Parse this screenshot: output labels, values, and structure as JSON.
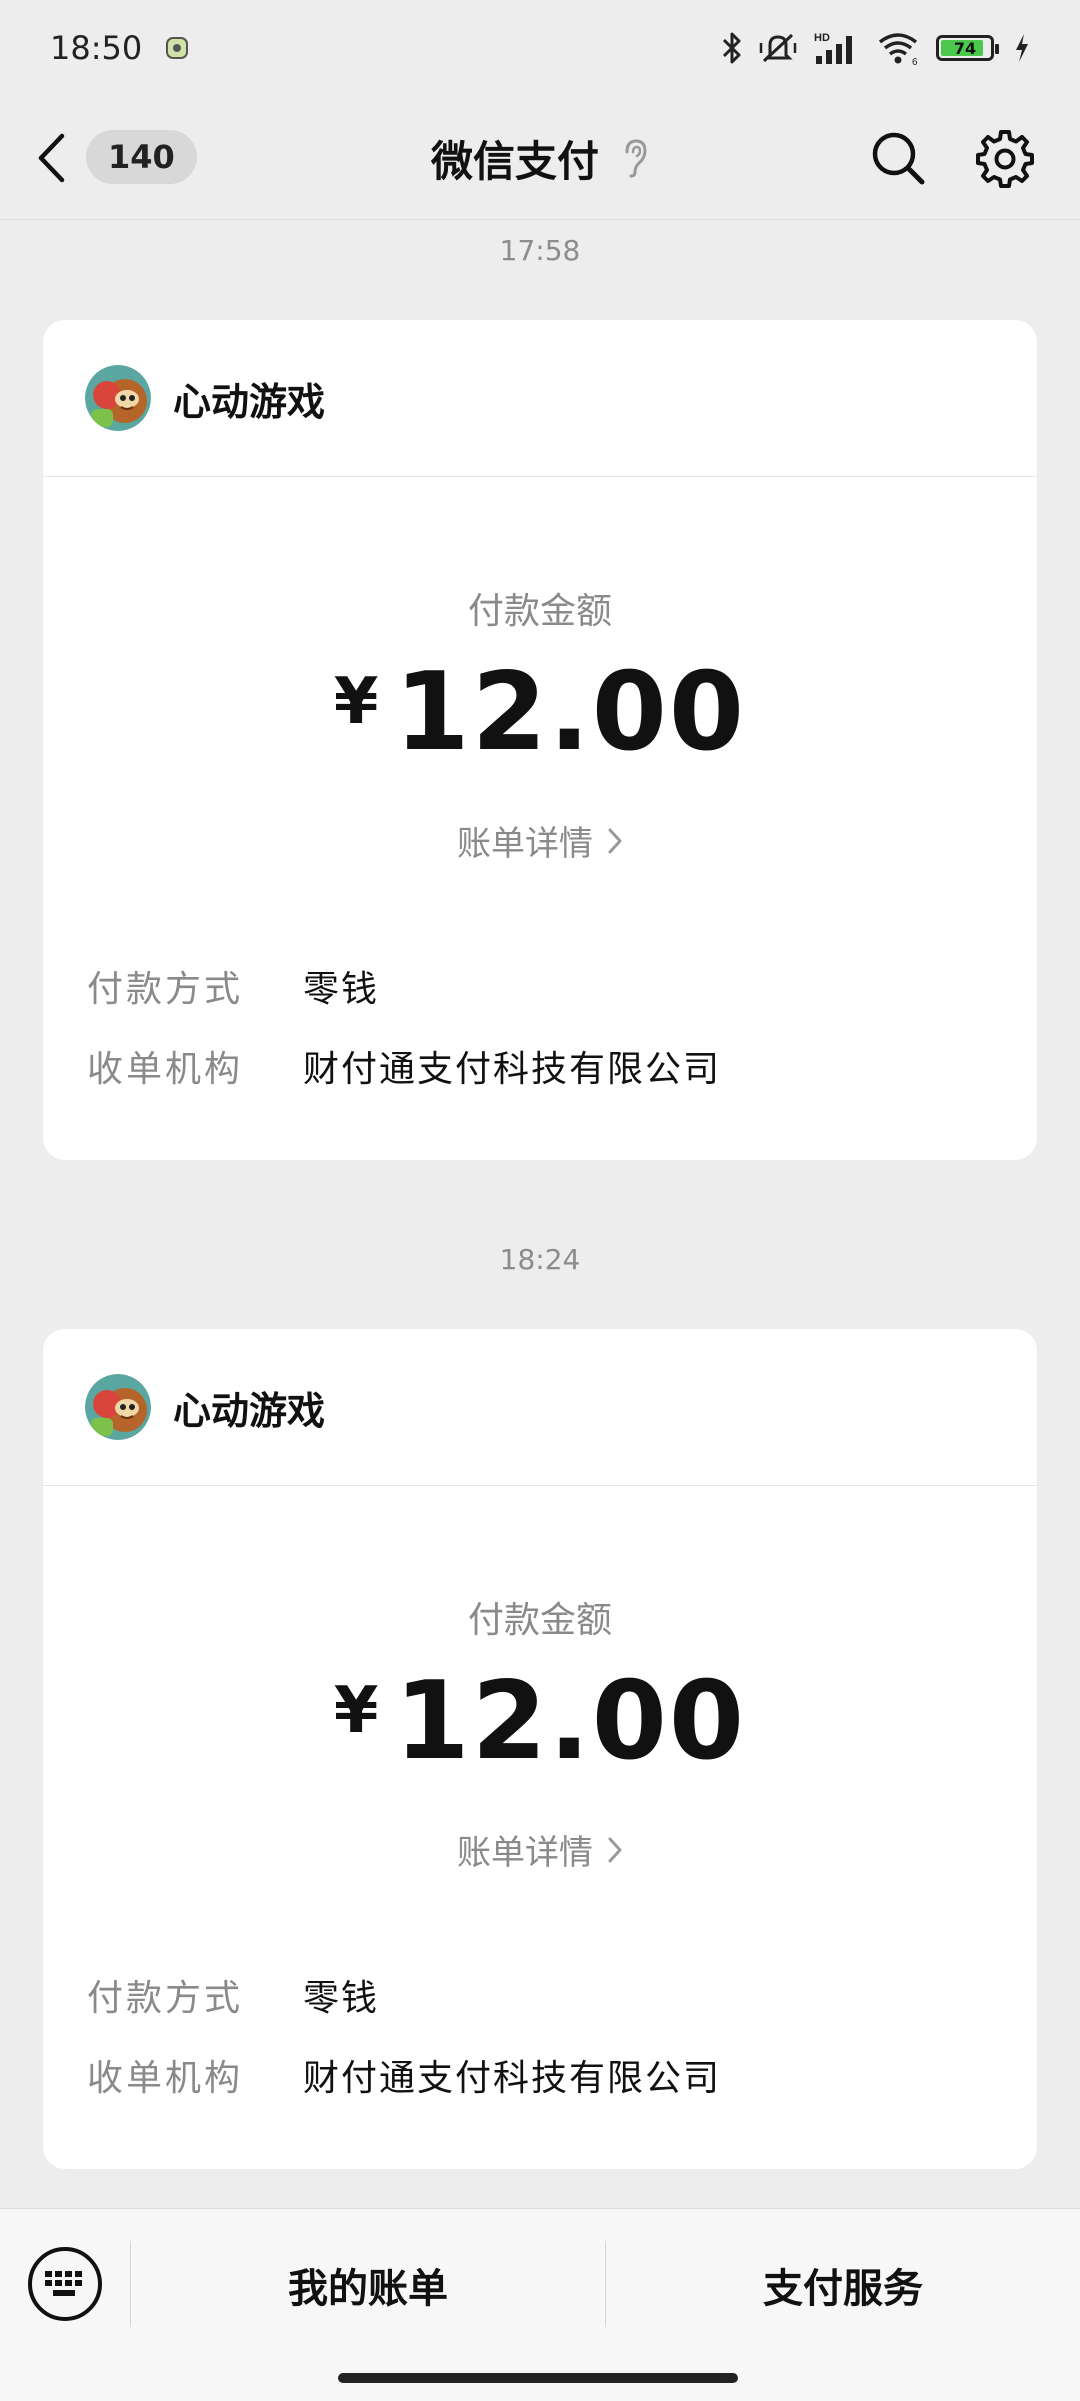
{
  "status_bar": {
    "time": "18:50",
    "battery_level": "74",
    "network_label": "HD"
  },
  "nav": {
    "unread_count": "140",
    "title": "微信支付"
  },
  "messages": [
    {
      "timestamp": "17:58",
      "merchant": "心动游戏",
      "amount_label": "付款金额",
      "currency": "¥",
      "amount": "12.00",
      "bill_link": "账单详情",
      "payment_method_label": "付款方式",
      "payment_method": "零钱",
      "acquirer_label": "收单机构",
      "acquirer": "财付通支付科技有限公司"
    },
    {
      "timestamp": "18:24",
      "merchant": "心动游戏",
      "amount_label": "付款金额",
      "currency": "¥",
      "amount": "12.00",
      "bill_link": "账单详情",
      "payment_method_label": "付款方式",
      "payment_method": "零钱",
      "acquirer_label": "收单机构",
      "acquirer": "财付通支付科技有限公司"
    }
  ],
  "bottom_bar": {
    "tab_bills": "我的账单",
    "tab_services": "支付服务"
  }
}
